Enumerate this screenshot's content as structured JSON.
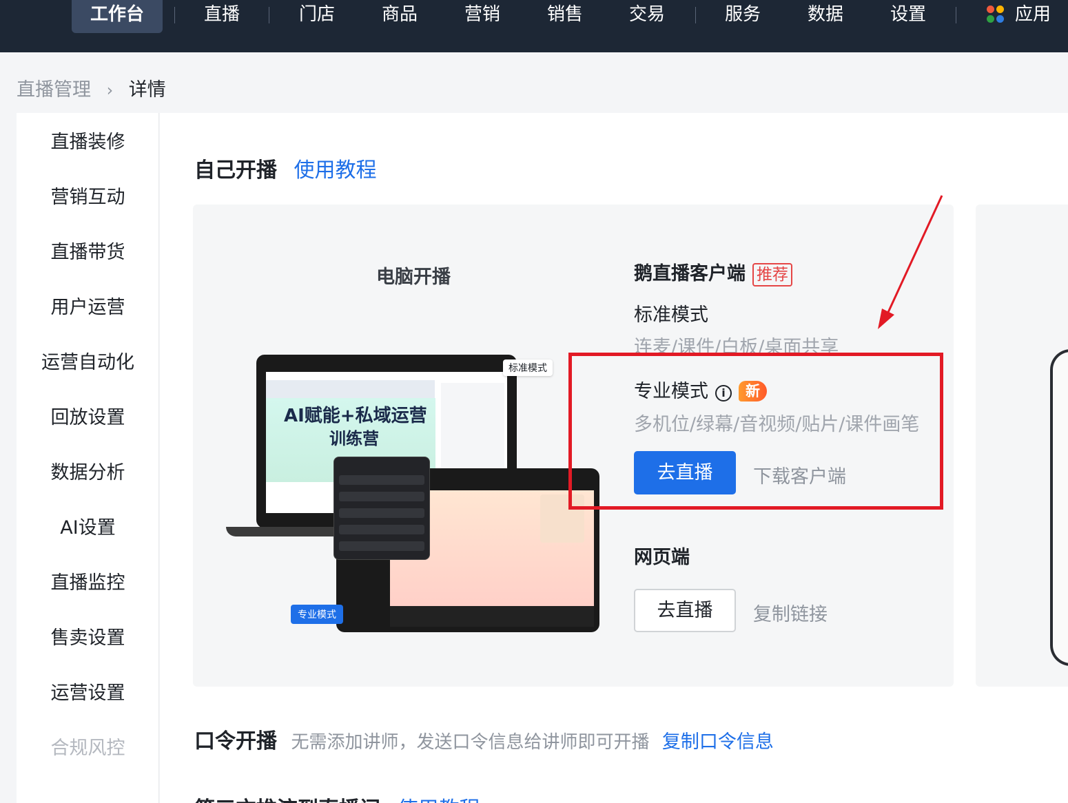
{
  "nav": {
    "items": [
      "工作台",
      "直播",
      "门店",
      "商品",
      "营销",
      "销售",
      "交易",
      "服务",
      "数据",
      "设置",
      "应用"
    ]
  },
  "breadcrumb": {
    "parent": "直播管理",
    "current": "详情"
  },
  "sidebar": {
    "items": [
      "直播装修",
      "营销互动",
      "直播带货",
      "用户运营",
      "运营自动化",
      "回放设置",
      "数据分析",
      "AI设置",
      "直播监控",
      "售卖设置",
      "运营设置",
      "合规风控"
    ]
  },
  "section1": {
    "title": "自己开播",
    "link": "使用教程"
  },
  "pc_card": {
    "title": "电脑开播",
    "illustration": {
      "tag_standard": "标准模式",
      "tag_pro": "专业模式",
      "promo_line1": "AI赋能+私域运营",
      "promo_line2": "训练营"
    }
  },
  "client": {
    "title": "鹅直播客户端",
    "badge": "推荐",
    "standard_mode": "标准模式",
    "standard_desc": "连麦/课件/白板/桌面共享",
    "pro_mode": "专业模式",
    "info_icon": "i",
    "new_badge": "新",
    "pro_desc": "多机位/绿幕/音视频/贴片/课件画笔",
    "go_live": "去直播",
    "download": "下载客户端"
  },
  "web": {
    "title": "网页端",
    "go_live": "去直播",
    "copy_link": "复制链接"
  },
  "section2": {
    "title": "口令开播",
    "desc": "无需添加讲师，发送口令信息给讲师即可开播",
    "link": "复制口令信息"
  },
  "section3": {
    "title": "第三方推流到直播间",
    "link": "使用教程"
  },
  "colors": {
    "accent": "#1e6fe8",
    "nav_bg": "#1d2735",
    "highlight": "#e21a25",
    "badge_red": "#e54545"
  }
}
